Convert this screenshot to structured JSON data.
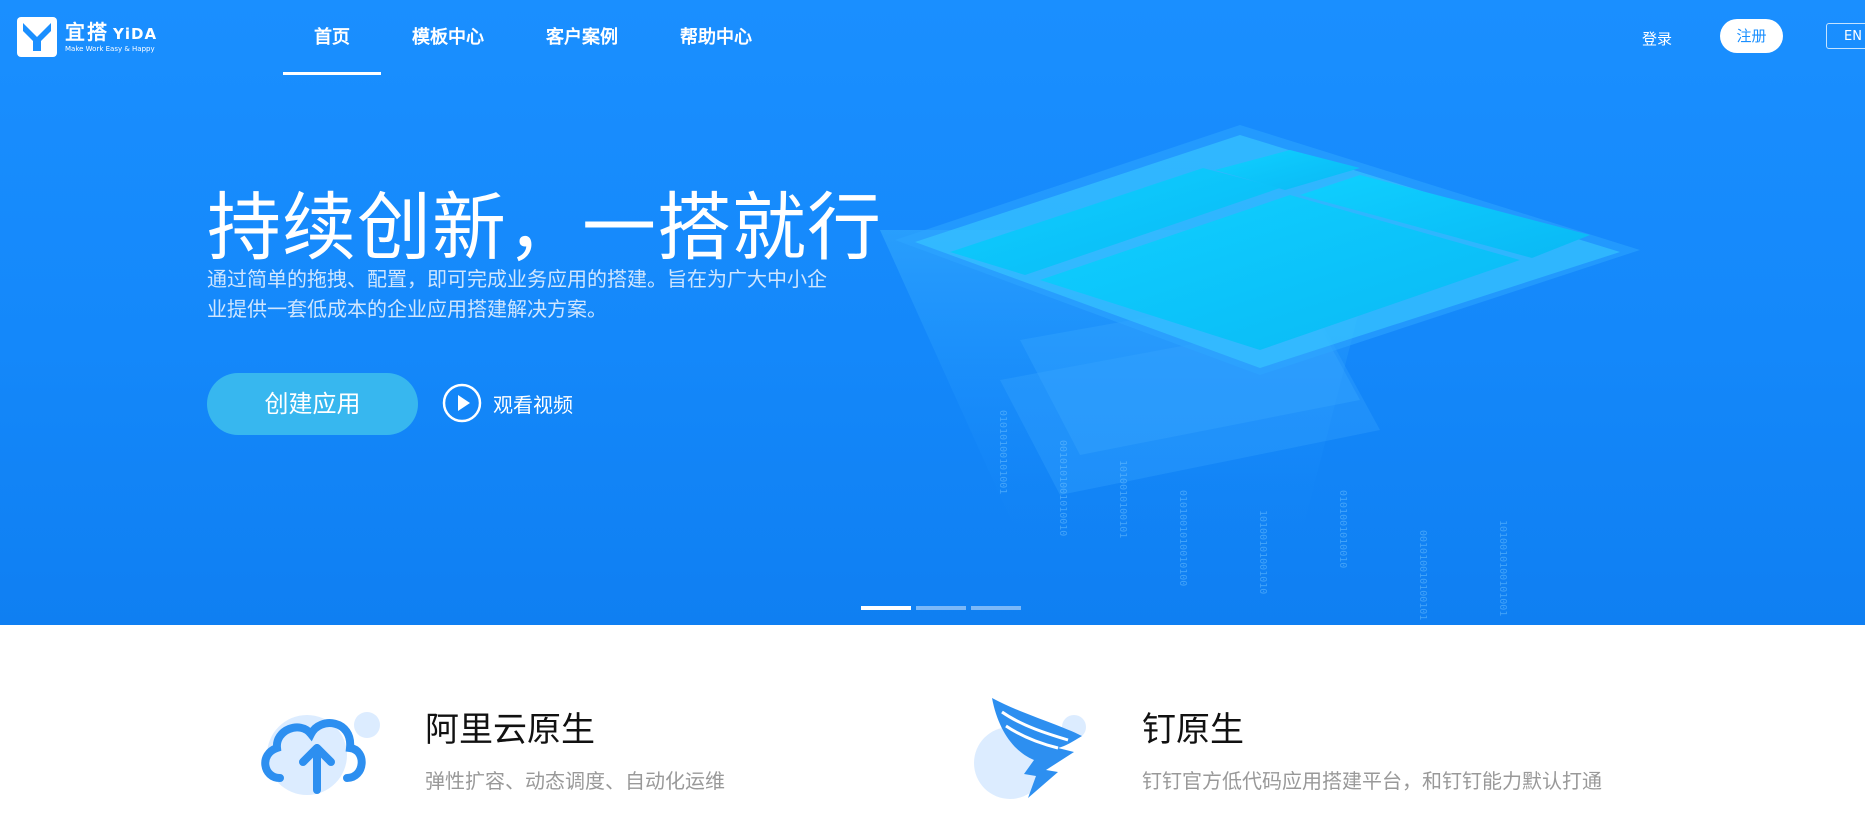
{
  "brand": {
    "name": "宜搭",
    "name_en": "YiDA",
    "slogan": "Make Work Easy & Happy"
  },
  "nav": {
    "items": [
      {
        "label": "首页",
        "active": true
      },
      {
        "label": "模板中心",
        "active": false
      },
      {
        "label": "客户案例",
        "active": false
      },
      {
        "label": "帮助中心",
        "active": false
      }
    ]
  },
  "auth": {
    "login": "登录",
    "register": "注册",
    "lang": "EN"
  },
  "hero": {
    "title": "持续创新，一搭就行",
    "subtitle_line1": "通过简单的拖拽、配置，即可完成业务应用的搭建。旨在为广大中小企",
    "subtitle_line2": "业提供一套低成本的企业应用搭建解决方案。",
    "cta": "创建应用",
    "watch_video": "观看视频",
    "carousel_count": 3,
    "carousel_active": 1
  },
  "features": [
    {
      "title": "阿里云原生",
      "desc": "弹性扩容、动态调度、自动化运维",
      "icon": "cloud-upload-icon"
    },
    {
      "title": "钉原生",
      "desc": "钉钉官方低代码应用搭建平台，和钉钉能力默认打通",
      "icon": "dingtalk-icon"
    }
  ],
  "colors": {
    "hero_bg": "#1a8fff",
    "cta_bg": "#37b7ef",
    "accent_icon": "#2d8ff0"
  }
}
